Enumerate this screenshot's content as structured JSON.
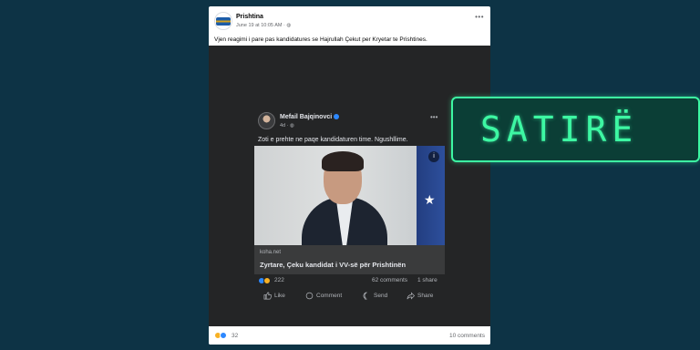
{
  "post": {
    "page_name": "Prishtina",
    "meta": "June 19 at 10:05 AM · ",
    "caption": "Vjen reagimi i pare pas kandidatures se Hajrullah Çekut per Kryetar te Prishtines.",
    "reaction_count": "32",
    "comments": "10 comments"
  },
  "embedded": {
    "author": "Mefail Bajqinovci",
    "meta": "4d · ",
    "text": "Zoti e prehte ne paqe kandidaturen time. Ngushllime.",
    "link_domain": "koha.net",
    "link_title": "Zyrtare, Çeku kandidat i VV-së për Prishtinën",
    "reaction_count": "222",
    "comments": "62 comments",
    "shares": "1 share",
    "actions": {
      "like": "Like",
      "comment": "Comment",
      "send": "Send",
      "share": "Share"
    }
  },
  "banner": {
    "label": "SATIRË"
  },
  "icons": [
    "globe-icon",
    "verified-icon",
    "more-icon",
    "info-icon",
    "like-reaction-icon",
    "haha-reaction-icon",
    "like-icon",
    "comment-icon",
    "send-icon",
    "share-icon"
  ],
  "colors": {
    "background": "#0d3345",
    "banner_accent": "#3df7a3",
    "dark_post": "#242526"
  }
}
